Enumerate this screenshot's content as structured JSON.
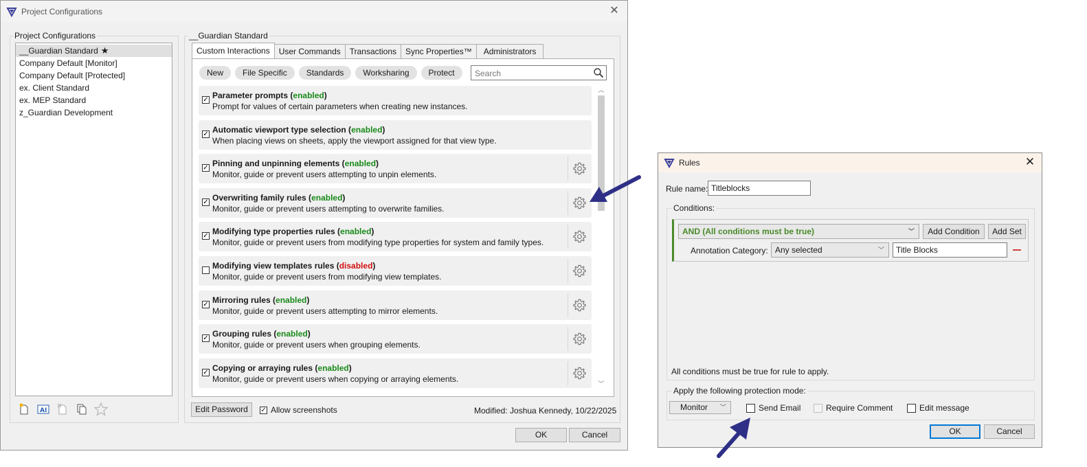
{
  "main_window": {
    "title": "Project Configurations",
    "close_glyph": "✕",
    "configurations_label": "Project Configurations",
    "configurations": [
      {
        "name": "__Guardian Standard",
        "selected": true,
        "starred": true
      },
      {
        "name": "Company Default [Monitor]",
        "selected": false,
        "starred": false
      },
      {
        "name": "Company Default [Protected]",
        "selected": false,
        "starred": false
      },
      {
        "name": "ex. Client Standard",
        "selected": false,
        "starred": false
      },
      {
        "name": "ex. MEP Standard",
        "selected": false,
        "starred": false
      },
      {
        "name": "z_Guardian Development",
        "selected": false,
        "starred": false
      }
    ],
    "star_glyph": "★",
    "bottom_icons": [
      "new-config-icon",
      "rename-config-icon",
      "delete-config-icon",
      "duplicate-config-icon",
      "favorite-star-icon"
    ],
    "detail_label": "__Guardian Standard",
    "tabs": [
      "Custom Interactions",
      "User Commands",
      "Transactions",
      "Sync Properties™",
      "Administrators"
    ],
    "active_tab": 0,
    "filters": [
      "New",
      "File Specific",
      "Standards",
      "Worksharing",
      "Protect"
    ],
    "search_placeholder": "Search",
    "rules": [
      {
        "title": "Parameter prompts",
        "status": "enabled",
        "enabled": true,
        "desc": "Prompt for values of certain parameters when creating new instances.",
        "has_settings": false
      },
      {
        "title": "Automatic viewport type selection",
        "status": "enabled",
        "enabled": true,
        "desc": "When placing views on sheets, apply the viewport assigned for that view type.",
        "has_settings": false
      },
      {
        "title": "Pinning and unpinning elements",
        "status": "enabled",
        "enabled": true,
        "desc": "Monitor, guide or prevent users attempting to unpin elements.",
        "has_settings": true
      },
      {
        "title": "Overwriting family rules",
        "status": "enabled",
        "enabled": true,
        "desc": "Monitor, guide or prevent users attempting to overwrite families.",
        "has_settings": true
      },
      {
        "title": "Modifying type properties rules",
        "status": "enabled",
        "enabled": true,
        "desc": "Monitor, guide or prevent users from modifying type properties for system and family types.",
        "has_settings": true
      },
      {
        "title": "Modifying view templates rules",
        "status": "disabled",
        "enabled": false,
        "desc": "Monitor, guide or prevent users from modifying view templates.",
        "has_settings": true
      },
      {
        "title": "Mirroring rules",
        "status": "enabled",
        "enabled": true,
        "desc": "Monitor, guide or prevent users attempting to mirror elements.",
        "has_settings": true
      },
      {
        "title": "Grouping rules",
        "status": "enabled",
        "enabled": true,
        "desc": "Monitor, guide or prevent users when grouping elements.",
        "has_settings": true
      },
      {
        "title": "Copying or arraying rules",
        "status": "enabled",
        "enabled": true,
        "desc": "Monitor, guide or prevent users when copying or arraying elements.",
        "has_settings": true
      }
    ],
    "edit_password_label": "Edit Password",
    "allow_screenshots_label": "Allow screenshots",
    "allow_screenshots_checked": true,
    "modified_text": "Modified: Joshua Kennedy, 10/22/2025",
    "ok_label": "OK",
    "cancel_label": "Cancel"
  },
  "rules_dialog": {
    "title": "Rules",
    "close_glyph": "✕",
    "rule_name_label": "Rule name:",
    "rule_name_value": "Titleblocks",
    "conditions_label": "Conditions:",
    "logic_value": "AND (All conditions must be true)",
    "add_condition_label": "Add Condition",
    "add_set_label": "Add Set",
    "condition_field_label": "Annotation Category:",
    "condition_operator": "Any selected",
    "condition_value": "Title Blocks",
    "conditions_note": "All conditions must be true for rule to apply.",
    "protection_label": "Apply the following protection mode:",
    "mode_value": "Monitor",
    "send_email_label": "Send Email",
    "require_comment_label": "Require Comment",
    "edit_message_label": "Edit message",
    "ok_label": "OK",
    "cancel_label": "Cancel"
  },
  "colors": {
    "enabled": "#1a8a1a",
    "disabled": "#d01010",
    "arrow": "#2e2f86",
    "and_green": "#4a8a2a",
    "accent": "#0078d7"
  }
}
